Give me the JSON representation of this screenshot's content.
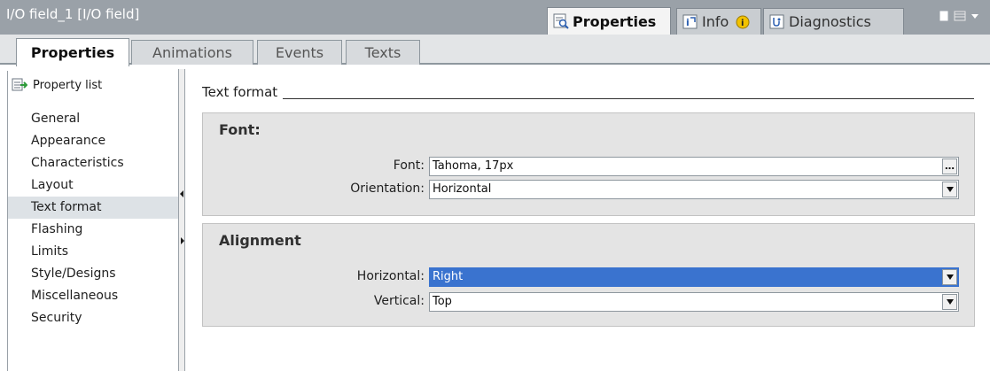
{
  "window": {
    "title": "I/O field_1 [I/O field]",
    "tabs": [
      {
        "label": "Properties",
        "icon": "properties-icon"
      },
      {
        "label": "Info",
        "icon": "info-icon"
      },
      {
        "label": "Diagnostics",
        "icon": "diagnostics-icon"
      }
    ]
  },
  "subtabs": [
    "Properties",
    "Animations",
    "Events",
    "Texts"
  ],
  "sidebar": {
    "property_list_label": "Property list",
    "items": [
      "General",
      "Appearance",
      "Characteristics",
      "Layout",
      "Text format",
      "Flashing",
      "Limits",
      "Style/Designs",
      "Miscellaneous",
      "Security"
    ],
    "selected": "Text format"
  },
  "section": {
    "title": "Text format"
  },
  "font_group": {
    "title": "Font:",
    "font_label": "Font:",
    "font_value": "Tahoma, 17px",
    "orientation_label": "Orientation:",
    "orientation_value": "Horizontal"
  },
  "alignment_group": {
    "title": "Alignment",
    "horizontal_label": "Horizontal:",
    "horizontal_value": "Right",
    "vertical_label": "Vertical:",
    "vertical_value": "Top"
  },
  "colors": {
    "titlebar": "#9aa1a8",
    "selection": "#3a73cf",
    "info_badge": "#f2c200"
  }
}
